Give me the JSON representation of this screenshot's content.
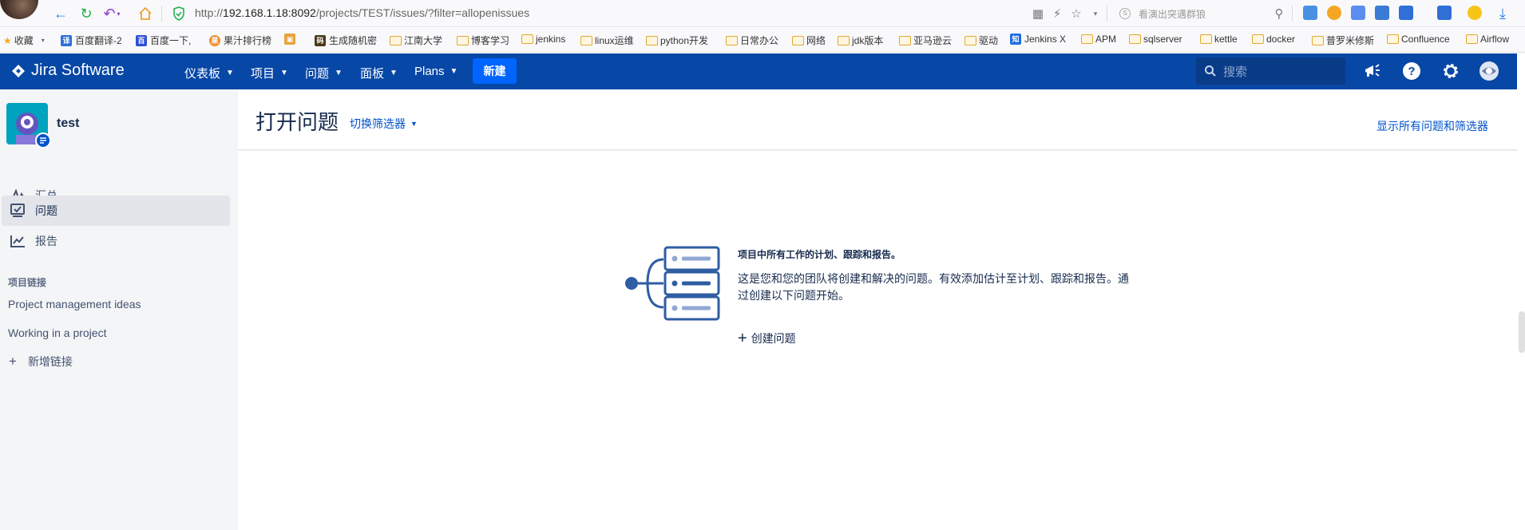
{
  "browser": {
    "url_prefix": "http://",
    "url_host": "192.168.1.18:8092",
    "url_path": "/projects/TEST/issues/?filter=allopenissues",
    "search_placeholder": "看演出突遇群狼",
    "bookmarks": [
      {
        "label": "收藏",
        "type": "star"
      },
      {
        "label": "百度翻译-2",
        "type": "site"
      },
      {
        "label": "百度一下,",
        "type": "site"
      },
      {
        "label": "果汁排行榜",
        "type": "site"
      },
      {
        "label": "",
        "type": "box"
      },
      {
        "label": "生成随机密",
        "type": "site"
      },
      {
        "label": "江南大学",
        "type": "folder"
      },
      {
        "label": "博客学习",
        "type": "folder"
      },
      {
        "label": "jenkins",
        "type": "folder"
      },
      {
        "label": "linux运维",
        "type": "folder"
      },
      {
        "label": "python开发",
        "type": "folder"
      },
      {
        "label": "日常办公",
        "type": "folder"
      },
      {
        "label": "网络",
        "type": "folder"
      },
      {
        "label": "jdk版本",
        "type": "folder"
      },
      {
        "label": "亚马逊云",
        "type": "folder"
      },
      {
        "label": "驱动",
        "type": "folder"
      },
      {
        "label": "Jenkins X",
        "type": "site"
      },
      {
        "label": "APM",
        "type": "folder"
      },
      {
        "label": "sqlserver",
        "type": "folder"
      },
      {
        "label": "kettle",
        "type": "folder"
      },
      {
        "label": "docker",
        "type": "folder"
      },
      {
        "label": "普罗米修斯",
        "type": "folder"
      },
      {
        "label": "Confluence",
        "type": "folder"
      },
      {
        "label": "Airflow",
        "type": "folder"
      }
    ]
  },
  "header": {
    "product": "Jira Software",
    "nav": [
      "仪表板",
      "项目",
      "问题",
      "面板",
      "Plans"
    ],
    "create_label": "新建",
    "search_placeholder": "搜索",
    "brand_color": "#0747a6"
  },
  "sidebar": {
    "project_name": "test",
    "items": [
      {
        "label": "汇总",
        "icon": "pulse-icon",
        "active": false
      },
      {
        "label": "问题",
        "icon": "issues-icon",
        "active": true
      },
      {
        "label": "报告",
        "icon": "reports-icon",
        "active": false
      }
    ],
    "links_heading": "项目链接",
    "links": [
      "Project management ideas",
      "Working in a project"
    ],
    "add_link_label": "新增链接"
  },
  "main": {
    "title": "打开问题",
    "switch_filter": "切换筛选器",
    "show_all": "显示所有问题和筛选器",
    "empty_title": "项目中所有工作的计划、跟踪和报告。",
    "empty_desc": "这是您和您的团队将创建和解决的问题。有效添加估计至计划、跟踪和报告。通过创建以下问题开始。",
    "create_issue": "创建问题"
  }
}
